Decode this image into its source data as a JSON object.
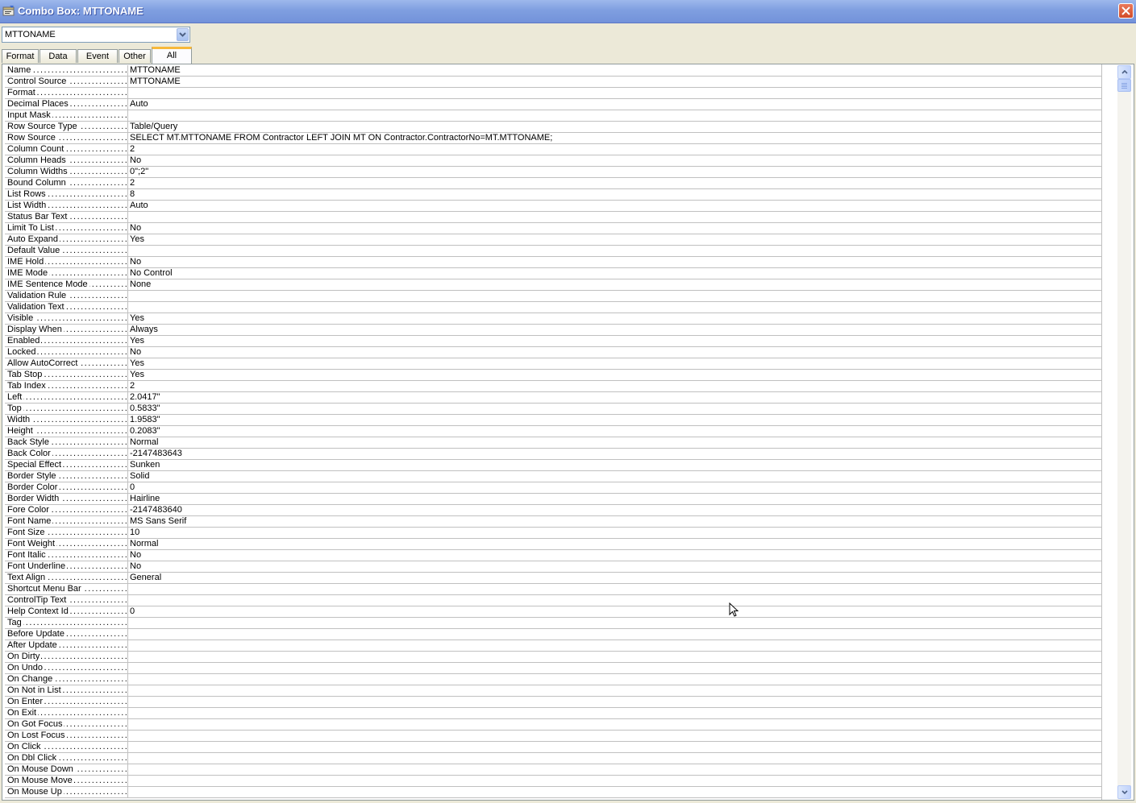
{
  "window": {
    "title": "Combo Box: MTTONAME"
  },
  "selector": {
    "value": "MTTONAME"
  },
  "tabs": [
    {
      "label": "Format"
    },
    {
      "label": "Data"
    },
    {
      "label": "Event"
    },
    {
      "label": "Other"
    },
    {
      "label": "All"
    }
  ],
  "active_tab": "All",
  "properties": [
    {
      "name": "Name",
      "value": "MTTONAME"
    },
    {
      "name": "Control Source",
      "value": "MTTONAME"
    },
    {
      "name": "Format",
      "value": ""
    },
    {
      "name": "Decimal Places",
      "value": "Auto"
    },
    {
      "name": "Input Mask",
      "value": ""
    },
    {
      "name": "Row Source Type",
      "value": "Table/Query"
    },
    {
      "name": "Row Source",
      "value": "SELECT MT.MTTONAME FROM Contractor LEFT JOIN MT ON Contractor.ContractorNo=MT.MTTONAME;"
    },
    {
      "name": "Column Count",
      "value": "2"
    },
    {
      "name": "Column Heads",
      "value": "No"
    },
    {
      "name": "Column Widths",
      "value": "0\";2\""
    },
    {
      "name": "Bound Column",
      "value": "2"
    },
    {
      "name": "List Rows",
      "value": "8"
    },
    {
      "name": "List Width",
      "value": "Auto"
    },
    {
      "name": "Status Bar Text",
      "value": ""
    },
    {
      "name": "Limit To List",
      "value": "No"
    },
    {
      "name": "Auto Expand",
      "value": "Yes"
    },
    {
      "name": "Default Value",
      "value": ""
    },
    {
      "name": "IME Hold",
      "value": "No"
    },
    {
      "name": "IME Mode",
      "value": "No Control"
    },
    {
      "name": "IME Sentence Mode",
      "value": "None"
    },
    {
      "name": "Validation Rule",
      "value": ""
    },
    {
      "name": "Validation Text",
      "value": ""
    },
    {
      "name": "Visible",
      "value": "Yes"
    },
    {
      "name": "Display When",
      "value": "Always"
    },
    {
      "name": "Enabled",
      "value": "Yes"
    },
    {
      "name": "Locked",
      "value": "No"
    },
    {
      "name": "Allow AutoCorrect",
      "value": "Yes"
    },
    {
      "name": "Tab Stop",
      "value": "Yes"
    },
    {
      "name": "Tab Index",
      "value": "2"
    },
    {
      "name": "Left",
      "value": "2.0417\""
    },
    {
      "name": "Top",
      "value": "0.5833\""
    },
    {
      "name": "Width",
      "value": "1.9583\""
    },
    {
      "name": "Height",
      "value": "0.2083\""
    },
    {
      "name": "Back Style",
      "value": "Normal"
    },
    {
      "name": "Back Color",
      "value": "-2147483643"
    },
    {
      "name": "Special Effect",
      "value": "Sunken"
    },
    {
      "name": "Border Style",
      "value": "Solid"
    },
    {
      "name": "Border Color",
      "value": "0"
    },
    {
      "name": "Border Width",
      "value": "Hairline"
    },
    {
      "name": "Fore Color",
      "value": "-2147483640"
    },
    {
      "name": "Font Name",
      "value": "MS Sans Serif"
    },
    {
      "name": "Font Size",
      "value": "10"
    },
    {
      "name": "Font Weight",
      "value": "Normal"
    },
    {
      "name": "Font Italic",
      "value": "No"
    },
    {
      "name": "Font Underline",
      "value": "No"
    },
    {
      "name": "Text Align",
      "value": "General"
    },
    {
      "name": "Shortcut Menu Bar",
      "value": ""
    },
    {
      "name": "ControlTip Text",
      "value": ""
    },
    {
      "name": "Help Context Id",
      "value": "0"
    },
    {
      "name": "Tag",
      "value": ""
    },
    {
      "name": "Before Update",
      "value": ""
    },
    {
      "name": "After Update",
      "value": ""
    },
    {
      "name": "On Dirty",
      "value": ""
    },
    {
      "name": "On Undo",
      "value": ""
    },
    {
      "name": "On Change",
      "value": ""
    },
    {
      "name": "On Not in List",
      "value": ""
    },
    {
      "name": "On Enter",
      "value": ""
    },
    {
      "name": "On Exit",
      "value": ""
    },
    {
      "name": "On Got Focus",
      "value": ""
    },
    {
      "name": "On Lost Focus",
      "value": ""
    },
    {
      "name": "On Click",
      "value": ""
    },
    {
      "name": "On Dbl Click",
      "value": ""
    },
    {
      "name": "On Mouse Down",
      "value": ""
    },
    {
      "name": "On Mouse Move",
      "value": ""
    },
    {
      "name": "On Mouse Up",
      "value": ""
    }
  ],
  "icons": {
    "window": "properties-window-icon",
    "close": "close-icon",
    "dropdown": "chevron-down-icon",
    "scroll_up": "arrow-up-icon",
    "scroll_down": "arrow-down-icon",
    "cursor": "mouse-pointer-icon"
  },
  "colors": {
    "titlebar": "#7f9fe0",
    "active_tab_accent": "#f7b83a",
    "close_button": "#d24b28",
    "grid_line": "#c0c0c0"
  }
}
